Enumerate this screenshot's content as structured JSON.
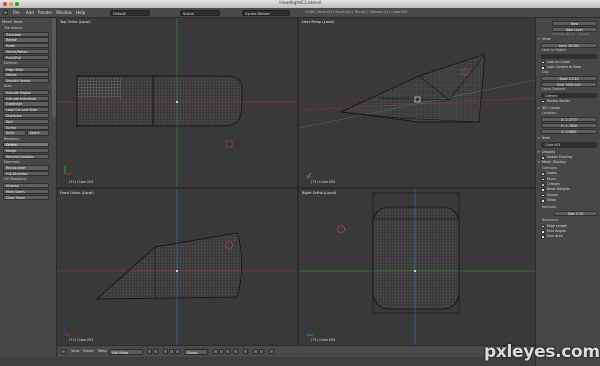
{
  "window": {
    "title": "HeadlightE3.blend"
  },
  "menubar": {
    "items": [
      "File",
      "Add",
      "Render",
      "Window",
      "Help"
    ],
    "layout_field": "Default",
    "scene_field": "Scene",
    "engine_field": "Cycles Render",
    "stats": "v2.69 | Verts:0/3 | Faces:0/2 | Tris:0/2 | Objects:1/1 | Cube.003"
  },
  "toolshelf": {
    "header": "Mesh Tools",
    "sections": [
      {
        "title": "Transform:",
        "buttons": [
          "Translate",
          "Rotate",
          "Scale",
          "Shrink/Fatten",
          "Push/Pull"
        ]
      },
      {
        "title": "Deform:",
        "buttons": [
          "Edge Slide",
          "Vertex",
          "Smooth Vertex"
        ]
      },
      {
        "title": "Add:",
        "buttons": [
          "Extrude Region",
          "Extrude Individual",
          "Subdivide",
          "Loop Cut and Slide",
          "Duplicate",
          "Spin",
          "Screw"
        ],
        "pair": [
          "Knife",
          "Select"
        ]
      },
      {
        "title": "Remove:",
        "buttons": [
          "Delete",
          "Merge",
          "Remove Doubles"
        ]
      },
      {
        "title": "Normals:",
        "buttons": [
          "Recalculate",
          "Flip Direction"
        ]
      },
      {
        "title": "UV Mapping:",
        "buttons": [
          "Unwrap",
          "Mark Seam",
          "Clear Seam"
        ]
      }
    ]
  },
  "viewports": {
    "top": {
      "label": "Top Ortho (Local)",
      "object": "(71) Cube.003"
    },
    "user": {
      "label": "User Persp (Local)",
      "object": "(71) Cube.003"
    },
    "front": {
      "label": "Front Ortho (Local)",
      "object": "(71) Cube.003"
    },
    "right": {
      "label": "Right Ortho (Local)",
      "object": "(71) Cube.003"
    }
  },
  "bottombar": {
    "view": "View",
    "select": "Select",
    "mesh": "Mesh",
    "mode": "Edit Mode",
    "pivot": "Global"
  },
  "properties": {
    "new_label": "New",
    "new_layer_label": "New Layer",
    "tabs": [
      "Unknown layout",
      "Uknown"
    ],
    "view_header": "View",
    "lens_label": "Lens: 35.000",
    "lock_to_object": "Lock to Object:",
    "lock_to_cursor": "Lock to Cursor",
    "lock_camera": "Lock Camera to View",
    "clip_label": "Clip:",
    "clip_start": "Start: 0.010",
    "clip_end": "End: 1000.000",
    "local_camera": "Local Camera:",
    "camera_field": "Camera",
    "render_border": "Render Border",
    "cursor_header": "3D Cursor",
    "location_label": "Location:",
    "cursor_x": "X: 2.3773",
    "cursor_y": "Y: -1.7826",
    "cursor_z": "Z: 0.9807",
    "item_header": "Item",
    "item_name": "Cube.003",
    "display_header": "Display",
    "motion_tracking": "Motion Tracking",
    "mesh_display_header": "Mesh Display",
    "overlays_label": "Overlays:",
    "overlays": [
      {
        "label": "Edges",
        "on": true
      },
      {
        "label": "Faces",
        "on": true
      },
      {
        "label": "Creases",
        "on": true
      },
      {
        "label": "Bevel Weights",
        "on": false
      },
      {
        "label": "Seams",
        "on": false
      },
      {
        "label": "Sharp",
        "on": false
      }
    ],
    "normals_label": "Normals:",
    "normals_size": "Size: 0.10",
    "numerics_label": "Numerics:",
    "numerics": [
      {
        "label": "Edge Length",
        "on": false
      },
      {
        "label": "Face Angles",
        "on": false
      },
      {
        "label": "Face Area",
        "on": false
      }
    ]
  },
  "watermark": "pxleyes.com",
  "colors": {
    "background": "#393939",
    "panel": "#474747",
    "grid_red": "#a33",
    "grid_green": "#3a3",
    "selection": "#f0f0f0"
  }
}
